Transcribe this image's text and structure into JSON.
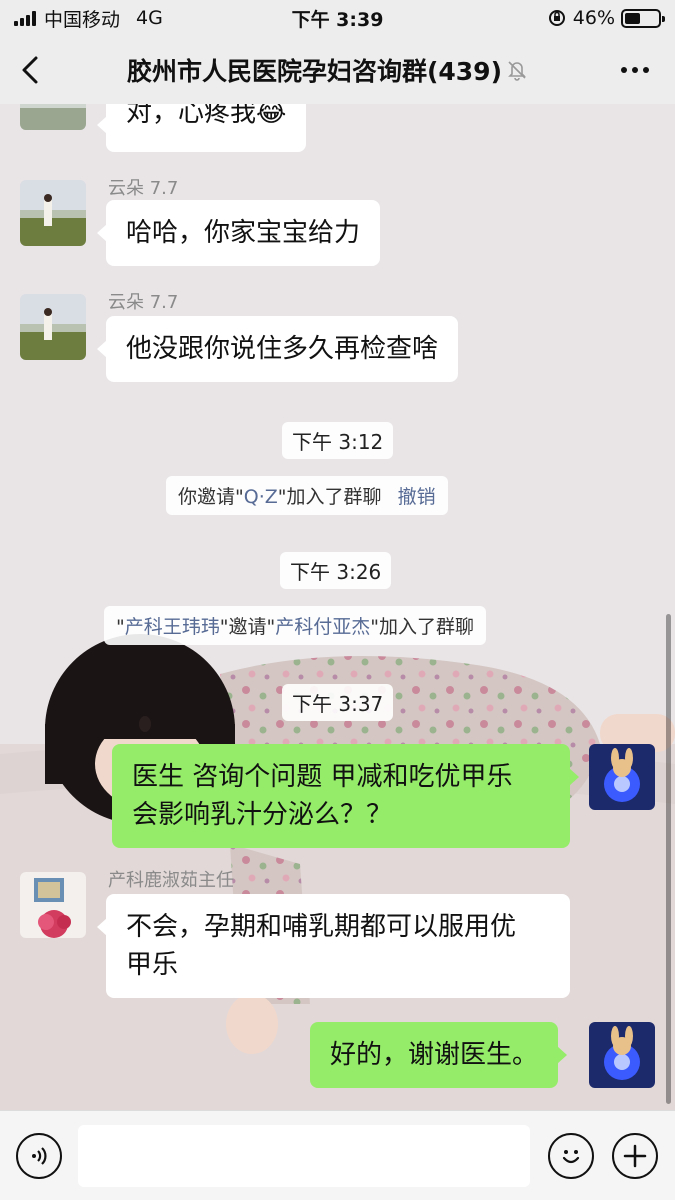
{
  "status_bar": {
    "carrier": "中国移动",
    "network": "4G",
    "time": "下午 3:39",
    "battery_percent": "46%",
    "battery_level": 0.46
  },
  "nav": {
    "title": "胶州市人民医院孕妇咨询群(439)",
    "muted": true
  },
  "chat": {
    "messages": [
      {
        "text": "对，心疼我😂"
      },
      {
        "sender": "云朵 7.7",
        "text": "哈哈，你家宝宝给力"
      },
      {
        "sender": "云朵 7.7",
        "text": "他没跟你说住多久再检查啥"
      },
      {
        "time": "下午 3:12"
      },
      {
        "system": {
          "pre": "你邀请\"",
          "name": "Q·Z",
          "post": "\"加入了群聊",
          "action": "撤销"
        }
      },
      {
        "time": "下午 3:26"
      },
      {
        "system": {
          "q1": "\"",
          "name1": "产科王玮玮",
          "mid": "\"邀请\"",
          "name2": "产科付亚杰",
          "post": "\"加入了群聊"
        }
      },
      {
        "time": "下午 3:37"
      },
      {
        "text_line1": "医生 咨询个问题 甲减和吃优甲乐",
        "text_line2": "会影响乳汁分泌么？？"
      },
      {
        "sender": "产科鹿淑茹主任",
        "text_line1": "不会，孕期和哺乳期都可以服用优",
        "text_line2": "甲乐"
      },
      {
        "text": "好的，谢谢医生。"
      }
    ]
  },
  "input": {
    "placeholder": ""
  },
  "colors": {
    "header_bg": "#ededed",
    "my_bubble": "#95ec69",
    "other_bubble": "#ffffff",
    "link": "#576b95"
  },
  "icons": [
    "signal-icon",
    "battery-icon",
    "back-icon",
    "mute-bell-icon",
    "more-icon",
    "voice-icon",
    "emoji-icon",
    "plus-icon"
  ]
}
